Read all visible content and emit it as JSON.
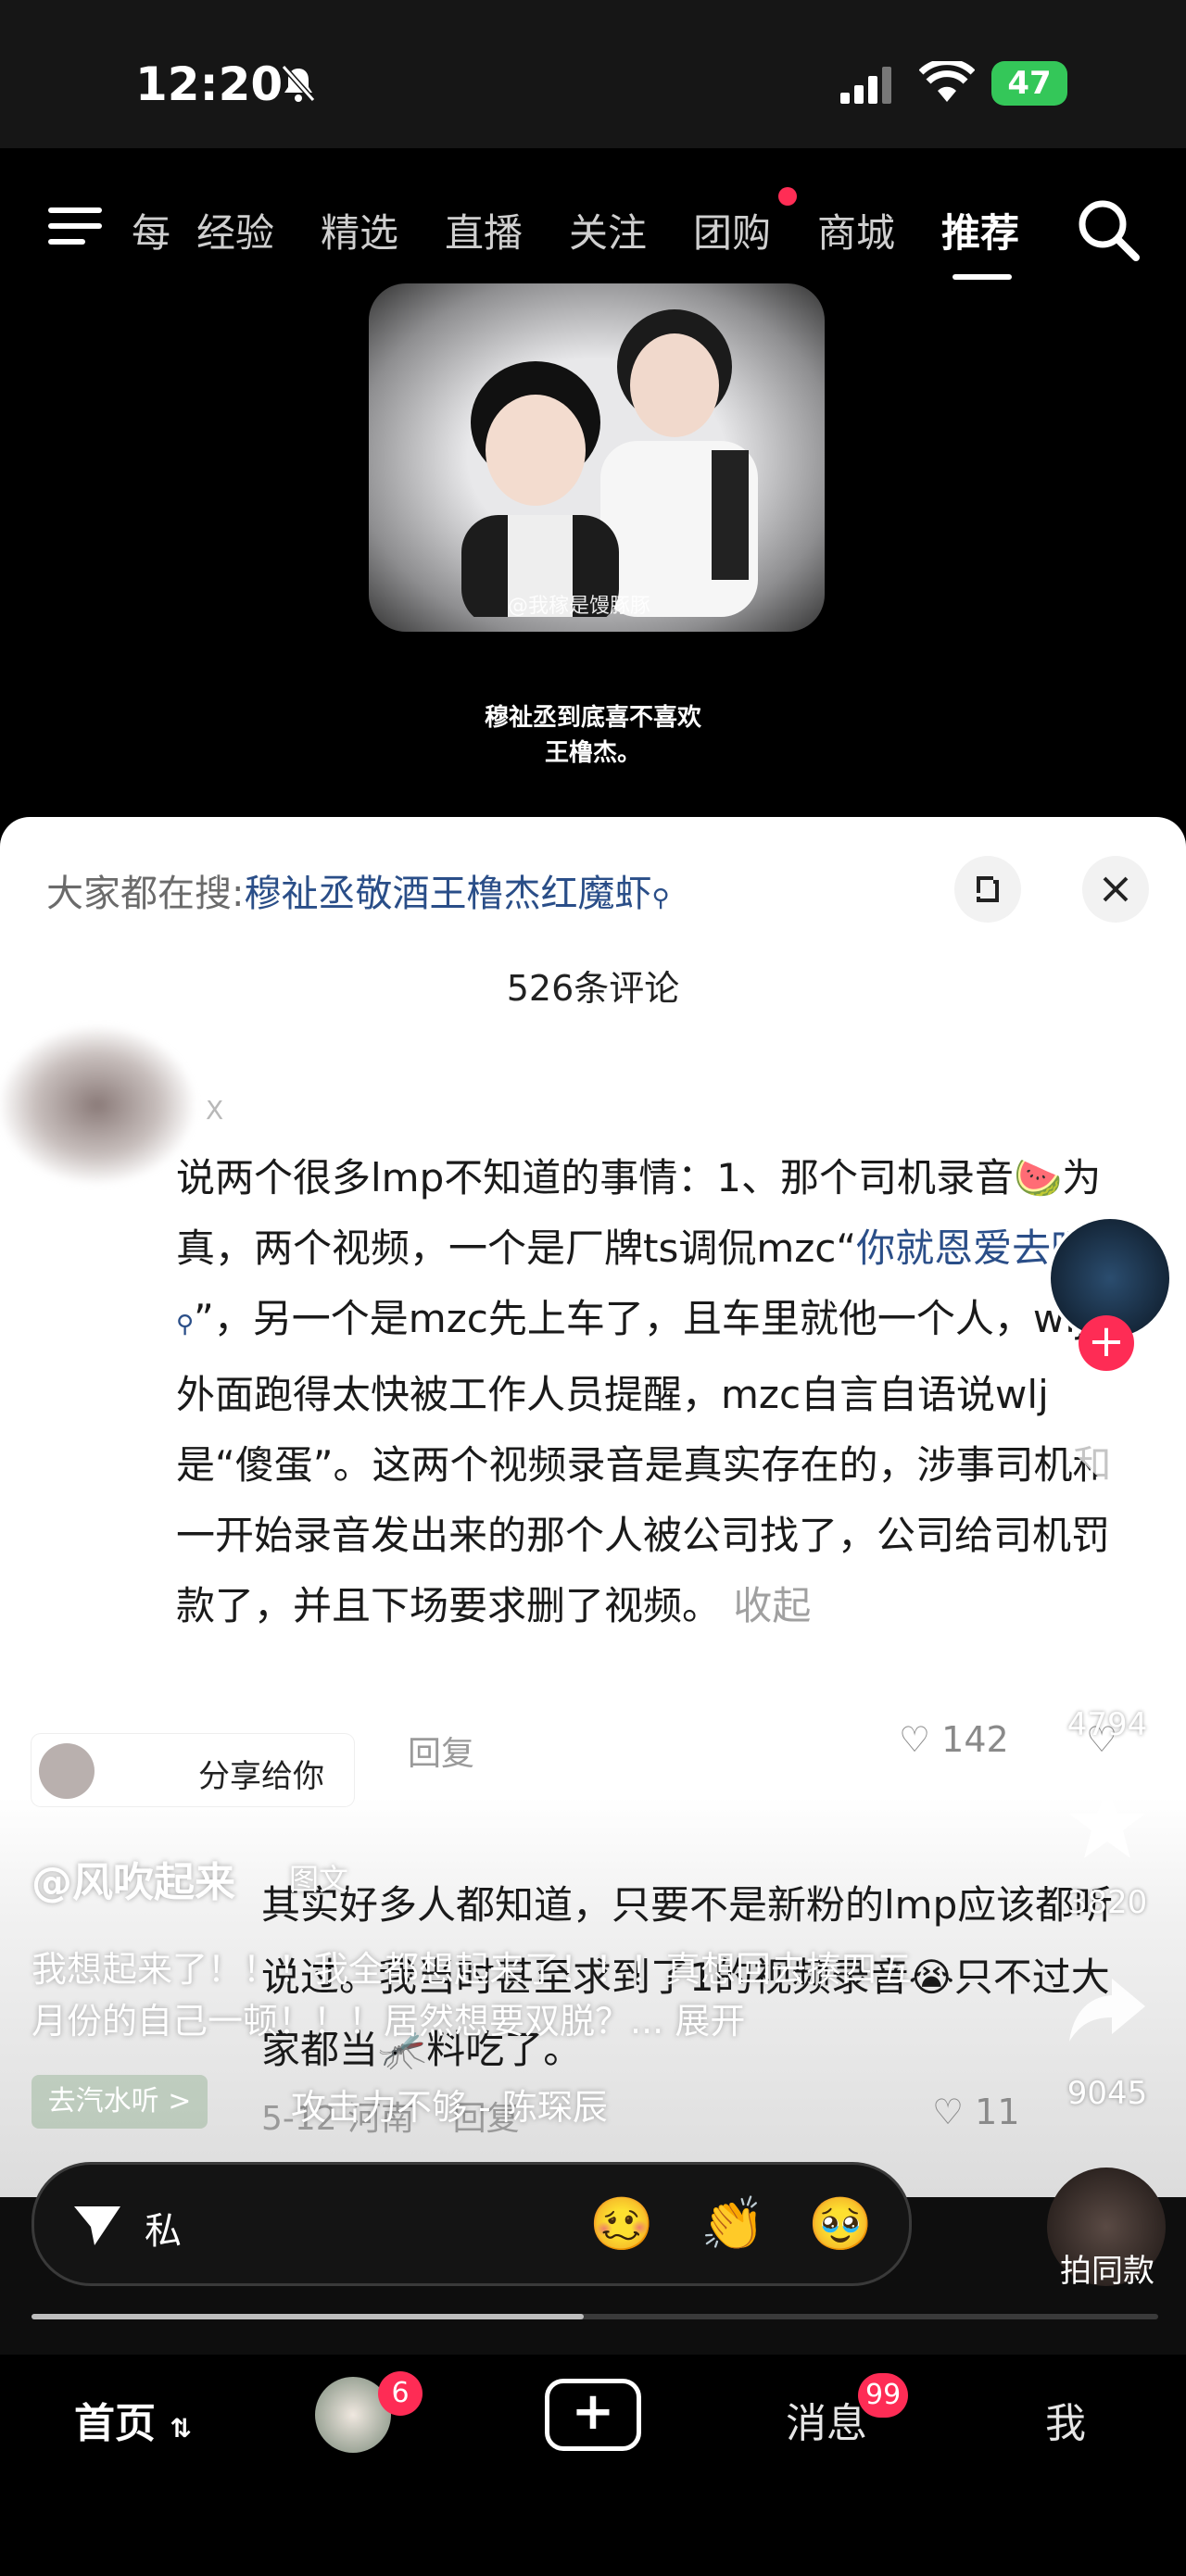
{
  "status_bar": {
    "time": "12:20",
    "battery": "47"
  },
  "top_nav": {
    "items": [
      "每",
      "经验",
      "精选",
      "直播",
      "关注",
      "团购",
      "商城",
      "推荐"
    ],
    "active": "推荐"
  },
  "video": {
    "watermark": "@我稼是馒豚豚",
    "caption_line1": "穆祉丞到底喜不喜欢",
    "caption_line2": "王橹杰。"
  },
  "panel": {
    "search_prefix": "大家都在搜:",
    "search_query": "穆祉丞敬酒王橹杰红魔虾",
    "comment_count": "526条评论"
  },
  "comment": {
    "author": "X",
    "text_part1": "说两个很多lmp不知道的事情：1、那个司机录音🍉为真，两个视频，一个是厂牌ts调侃mzc“",
    "text_link": "你就恩爱去吧",
    "text_part2": "”，另一个是mzc先上车了，且车里就他一个人，wlj在外面跑得太快被工作人员提醒，mzc自言自语说wlj是“傻蛋”。这两个视频录音是真实存在的，涉事司机和一开始录音发出来的那个人被公司找了，公司给司机罚款了，并且下场要求删了视频。",
    "collapse": "收起",
    "reply_label": "回复",
    "likes": "142"
  },
  "share_chip": {
    "text": "分享给你"
  },
  "reply": {
    "text": "其实好多人都知道，只要不是新粉的lmp应该都听说过。我当时甚至求到了1的视频录音😭只不过大家都当🦟料吃了。",
    "date": "5-12",
    "location": "河南",
    "reply_label": "回复",
    "likes": "11"
  },
  "post": {
    "author": "@风吹起来",
    "tag": "图文",
    "desc": "我想起来了！！！我全都想起来了！！！真想回去揍四五月份的自己一顿！！！居然想要双脱？...",
    "expand": "展开",
    "music_chip": "去汽水听 >",
    "music": "攻击力不够 - 陈琛辰"
  },
  "side": {
    "comments": "4794",
    "favorites": "3820",
    "shares": "9045",
    "clone_label": "拍同款"
  },
  "input": {
    "placeholder": "私",
    "emojis": [
      "🥴",
      "👏",
      "🥹"
    ]
  },
  "progress": {
    "fraction": 0.49
  },
  "tabbar": {
    "home": "首页",
    "friend_badge": "6",
    "messages": "消息",
    "messages_badge": "99",
    "me": "我"
  },
  "colors": {
    "accent_red": "#fe2c55",
    "link_blue": "#2a4e88",
    "battery_green": "#34c759"
  }
}
